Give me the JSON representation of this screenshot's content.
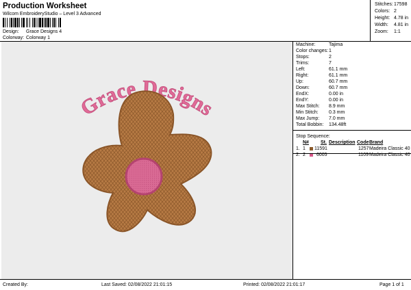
{
  "header": {
    "title": "Production Worksheet",
    "subtitle": "Wilcom EmbroideryStudio – Level 3 Advanced",
    "design_label": "Design:",
    "design_value": "Grace Designs 4",
    "colorway_label": "Colorway:",
    "colorway_value": "Colorway 1"
  },
  "stats": [
    {
      "label": "Stitches:",
      "value": "17598"
    },
    {
      "label": "Colors:",
      "value": "2"
    },
    {
      "label": "Height:",
      "value": "4.78 in"
    },
    {
      "label": "Width:",
      "value": "4.81 in"
    },
    {
      "label": "Zoom:",
      "value": "1:1"
    }
  ],
  "machine_info": [
    {
      "label": "Machine:",
      "value": "Tajima"
    },
    {
      "label": "Color changes:",
      "value": "1"
    },
    {
      "label": "Stops:",
      "value": "2"
    },
    {
      "label": "Trims:",
      "value": "7"
    },
    {
      "label": "Left:",
      "value": "61.1 mm"
    },
    {
      "label": "Right:",
      "value": "61.1 mm"
    },
    {
      "label": "Up:",
      "value": "60.7 mm"
    },
    {
      "label": "Down:",
      "value": "60.7 mm"
    },
    {
      "label": "EndX:",
      "value": "0.00 in"
    },
    {
      "label": "EndY:",
      "value": "0.00 in"
    },
    {
      "label": "Max Stitch:",
      "value": "8.9 mm"
    },
    {
      "label": "Min Stitch:",
      "value": "0.3 mm"
    },
    {
      "label": "Max Jump:",
      "value": "7.0 mm"
    },
    {
      "label": "Total Bobbin:",
      "value": "134.48ft"
    }
  ],
  "stop_sequence": {
    "title": "Stop Sequence:",
    "headers": {
      "n": "N#",
      "st": "St.",
      "description": "Description",
      "code": "Code",
      "brand": "Brand"
    },
    "rows": [
      {
        "index": "1.",
        "n": "1",
        "color": "#8B5A2B",
        "st": "11591",
        "description": "",
        "code": "1257",
        "brand": "Madeira Classic 40"
      },
      {
        "index": "2.",
        "n": "2",
        "color": "#D9588A",
        "st": "6005",
        "description": "",
        "code": "1109",
        "brand": "Madeira Classic 40"
      }
    ]
  },
  "design_preview": {
    "text": "Grace Designs",
    "text_color": "#E06A97",
    "petal_color": "#B77B45",
    "petal_outline": "#8A5528",
    "center_color": "#D96A94",
    "fabric_color": "#ECECEC"
  },
  "footer": {
    "created_by": "Created By:",
    "last_saved": "Last Saved: 02/08/2022 21:01:15",
    "printed": "Printed: 02/08/2022 21:01:17",
    "page": "Page 1 of 1"
  }
}
